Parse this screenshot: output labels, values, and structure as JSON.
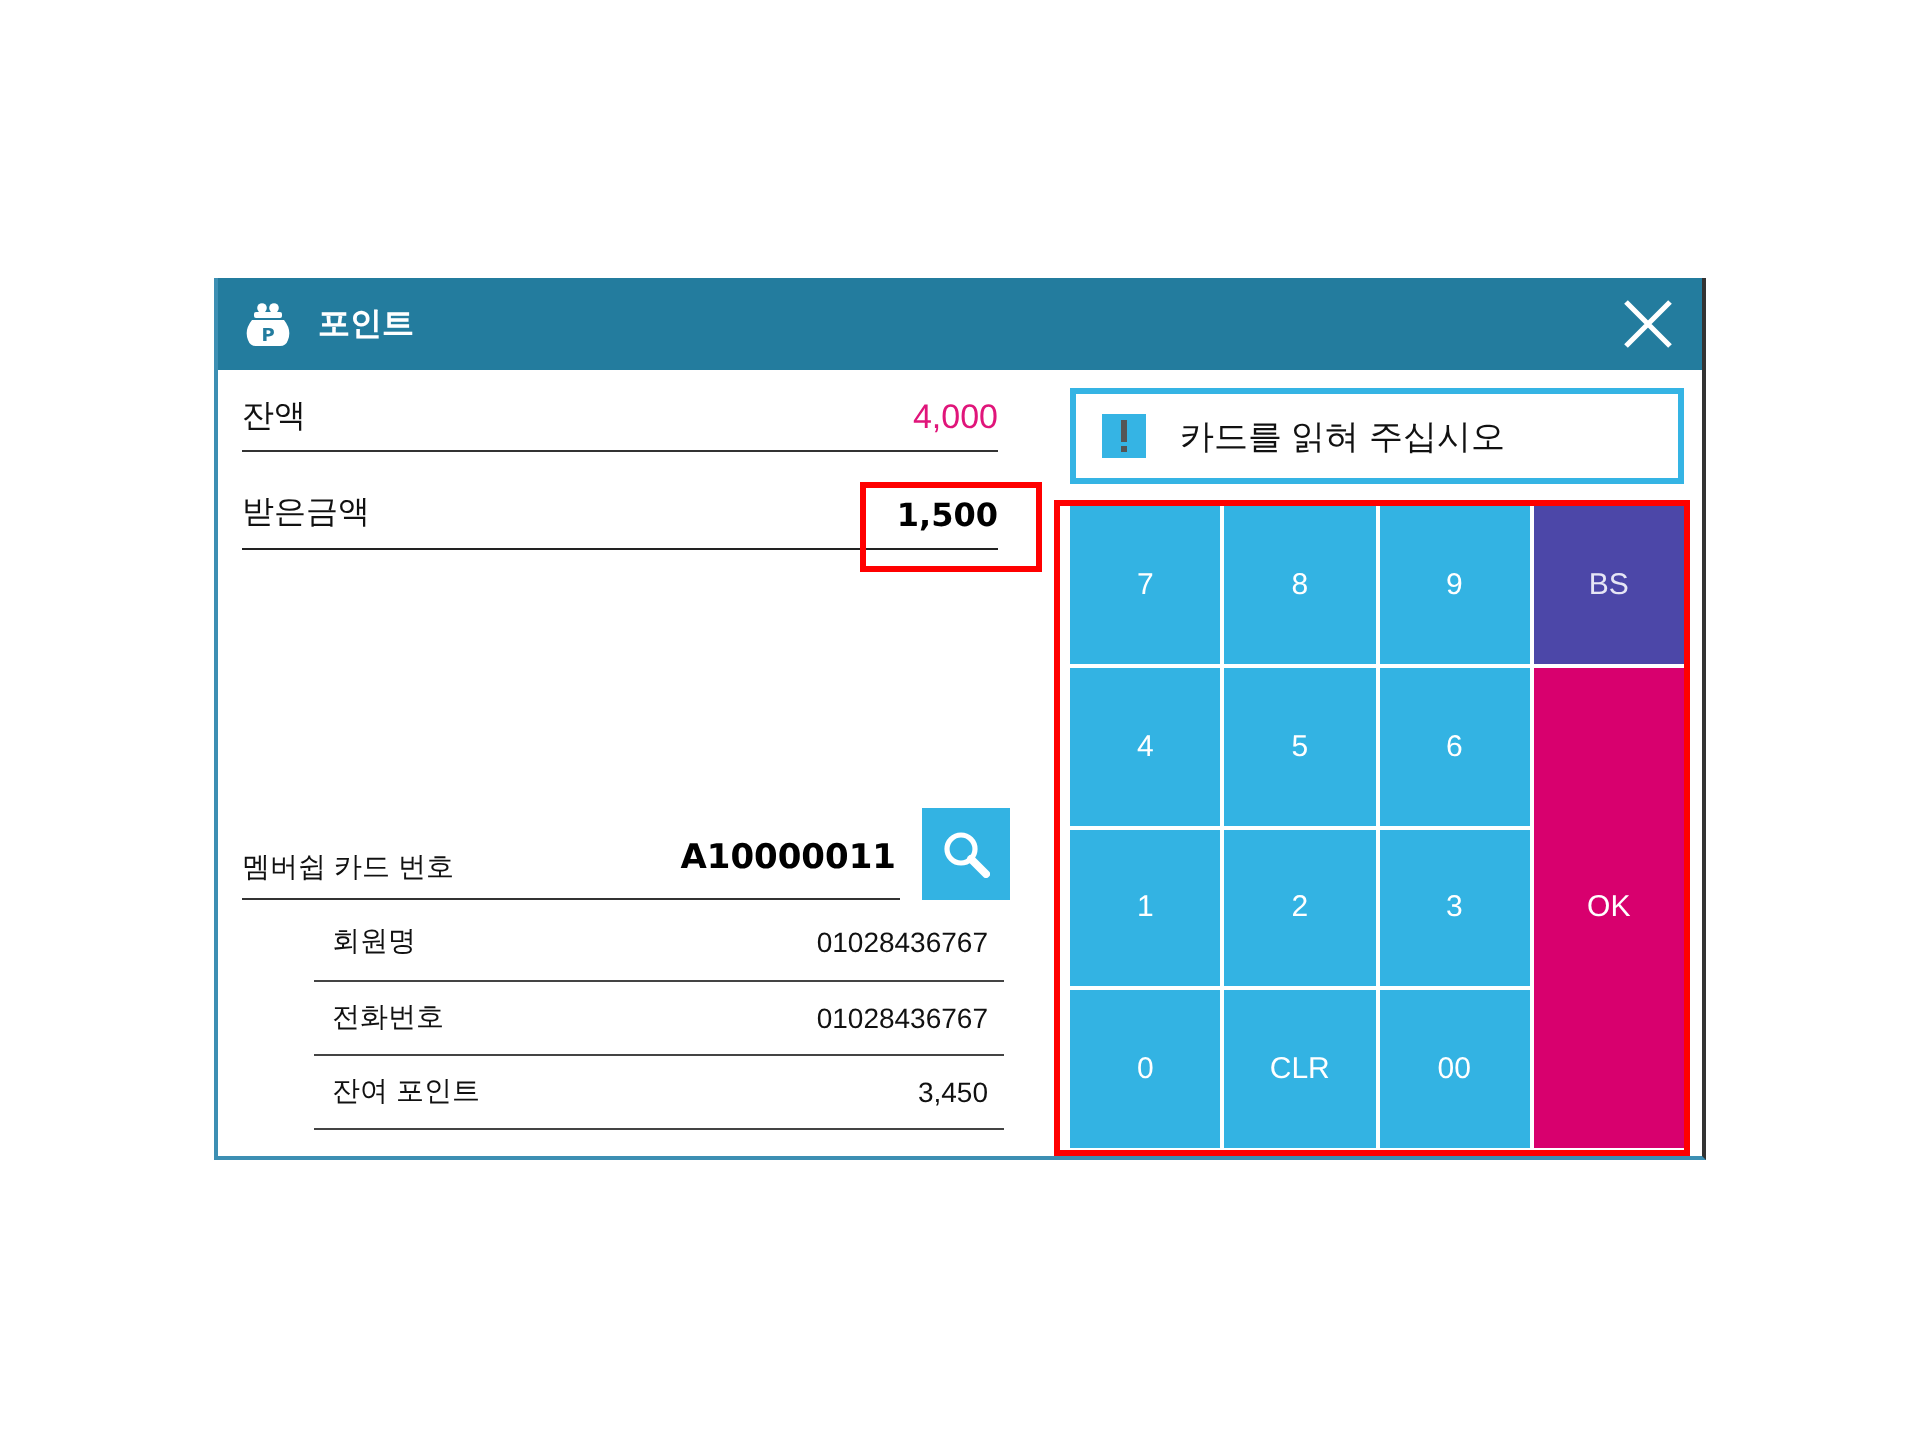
{
  "window": {
    "title": "포인트",
    "icon_letter": "P"
  },
  "summary": [
    {
      "label": "잔액",
      "value": "4,000",
      "kind": "balance",
      "highlighted": false
    },
    {
      "label": "받은금액",
      "value": "1,500",
      "kind": "received",
      "highlighted": true
    }
  ],
  "membership": {
    "label": "멤버쉽 카드 번호",
    "value": "A10000011",
    "details": [
      {
        "label": "회원명",
        "value": "01028436767"
      },
      {
        "label": "전화번호",
        "value": "01028436767"
      },
      {
        "label": "잔여 포인트",
        "value": "3,450"
      }
    ]
  },
  "message": {
    "text": "카드를 읽혀 주십시오"
  },
  "keypad": {
    "highlighted": true,
    "keys": [
      {
        "label": "7",
        "kind": "standard"
      },
      {
        "label": "8",
        "kind": "standard"
      },
      {
        "label": "9",
        "kind": "standard"
      },
      {
        "label": "BS",
        "kind": "backspace"
      },
      {
        "label": "4",
        "kind": "standard"
      },
      {
        "label": "5",
        "kind": "standard"
      },
      {
        "label": "6",
        "kind": "standard"
      },
      {
        "label": "1",
        "kind": "standard"
      },
      {
        "label": "2",
        "kind": "standard"
      },
      {
        "label": "3",
        "kind": "standard"
      },
      {
        "label": "OK",
        "kind": "ok"
      },
      {
        "label": "0",
        "kind": "standard"
      },
      {
        "label": "CLR",
        "kind": "standard"
      },
      {
        "label": "00",
        "kind": "standard"
      }
    ]
  }
}
